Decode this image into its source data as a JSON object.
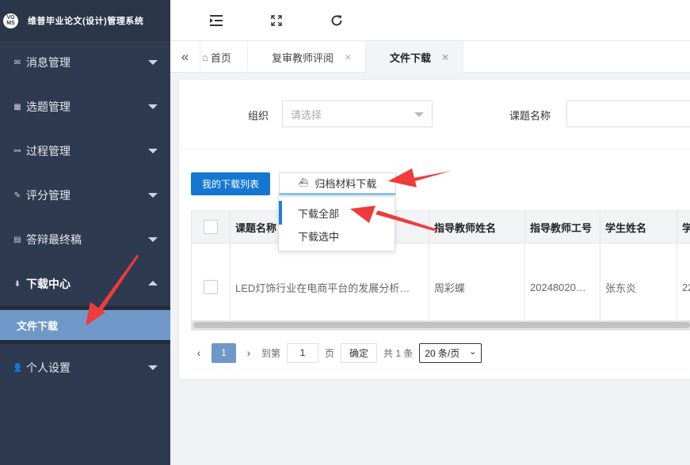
{
  "app": {
    "logo_top": "VG",
    "logo_bottom": "MS",
    "title": "维普毕业论文(设计)管理系统"
  },
  "sidebar": {
    "items": [
      {
        "label": "消息管理",
        "icon": "envelope-icon"
      },
      {
        "label": "选题管理",
        "icon": "grid-icon"
      },
      {
        "label": "过程管理",
        "icon": "binoculars-icon"
      },
      {
        "label": "评分管理",
        "icon": "edit-icon"
      },
      {
        "label": "答辩最终稿",
        "icon": "clipboard-icon"
      },
      {
        "label": "下载中心",
        "icon": "download-circle-icon",
        "expanded": true
      },
      {
        "label": "个人设置",
        "icon": "user-icon"
      }
    ],
    "submenu": {
      "label": "文件下载"
    }
  },
  "topbar": {
    "icons": [
      "indent-icon",
      "fullscreen-icon",
      "refresh-icon"
    ]
  },
  "tabs": {
    "nav_icon": "double-chevron-left-icon",
    "items": [
      {
        "label": "首页",
        "icon": "home-icon"
      },
      {
        "label": "复审教师评阅",
        "close": "×"
      },
      {
        "label": "文件下载",
        "close": "×",
        "active": true
      }
    ]
  },
  "filters": {
    "org_label": "组织",
    "org_placeholder": "请选择",
    "topic_label": "课题名称"
  },
  "actions": {
    "my_downloads": "我的下载列表",
    "archive_download": "归档材料下载"
  },
  "dropdown": {
    "items": [
      "下载全部",
      "下载选中"
    ]
  },
  "table": {
    "headers": [
      "课题名称",
      "指导教师姓名",
      "指导教师工号",
      "学生姓名",
      "学"
    ],
    "rows": [
      {
        "topic": "LED灯饰行业在电商平台的发展分析…",
        "teacher": "周彩蝶",
        "teacher_id": "20248020…",
        "student": "张东炎",
        "extra": "22"
      }
    ]
  },
  "pagination": {
    "current": "1",
    "goto_label": "到第",
    "goto_value": "1",
    "page_suffix": "页",
    "confirm": "确定",
    "total": "共 1 条",
    "page_size": "20 条/页"
  },
  "colors": {
    "sidebar_bg": "#2e3a50",
    "active_sub": "#6f98c8",
    "primary": "#1677d2",
    "annotation": "#ef3b3b"
  }
}
